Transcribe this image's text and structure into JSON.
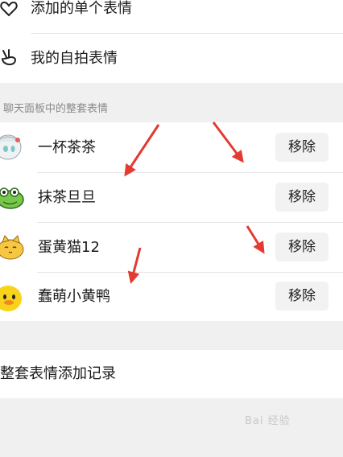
{
  "list_top": [
    {
      "label": "添加的单个表情",
      "icon": "heart-outline-icon"
    },
    {
      "label": "我的自拍表情",
      "icon": "peace-hand-icon"
    }
  ],
  "section": {
    "title": "聊天面板中的整套表情"
  },
  "packs": [
    {
      "name": "一杯茶茶",
      "button": "移除",
      "icon": "white-hair-girl-avatar"
    },
    {
      "name": "抹茶旦旦",
      "button": "移除",
      "icon": "green-frog-avatar"
    },
    {
      "name": "蛋黄猫12",
      "button": "移除",
      "icon": "yellow-cat-avatar"
    },
    {
      "name": "蠢萌小黄鸭",
      "button": "移除",
      "icon": "yellow-duck-avatar"
    }
  ],
  "history": {
    "label": "整套表情添加记录"
  },
  "annotation_color": "#e33b32",
  "watermark": "Bai 经验"
}
